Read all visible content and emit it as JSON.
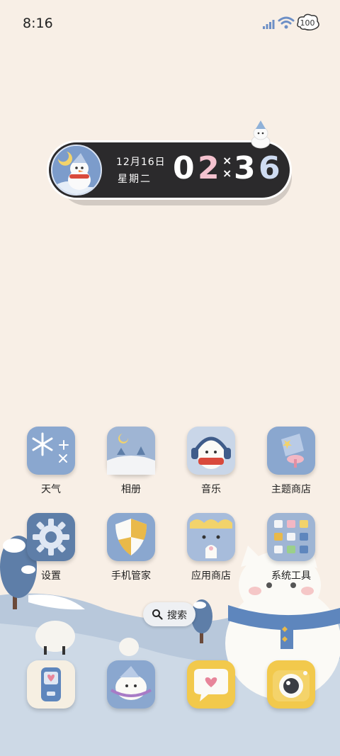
{
  "status_bar": {
    "time": "8:16",
    "battery": "100"
  },
  "clock_widget": {
    "date": "12月16日",
    "weekday": "星期二",
    "hour": "02",
    "minute": "36"
  },
  "apps_row1": [
    {
      "label": "天气",
      "icon": "snowflake-icon"
    },
    {
      "label": "相册",
      "icon": "gallery-icon"
    },
    {
      "label": "音乐",
      "icon": "headphones-icon"
    },
    {
      "label": "主题商店",
      "icon": "theme-store-icon"
    }
  ],
  "apps_row2": [
    {
      "label": "设置",
      "icon": "gear-icon"
    },
    {
      "label": "手机管家",
      "icon": "shield-icon"
    },
    {
      "label": "应用商店",
      "icon": "app-store-icon"
    },
    {
      "label": "系统工具",
      "icon": "tools-folder-icon"
    }
  ],
  "search": {
    "label": "搜索"
  },
  "dock": [
    {
      "icon": "phone-icon"
    },
    {
      "icon": "messages-icon"
    },
    {
      "icon": "chat-icon"
    },
    {
      "icon": "camera-icon"
    }
  ],
  "colors": {
    "background": "#f8efe6",
    "widget": "#2b2a2c",
    "accent_blue": "#8fb1d8",
    "snow": "#ffffff"
  }
}
